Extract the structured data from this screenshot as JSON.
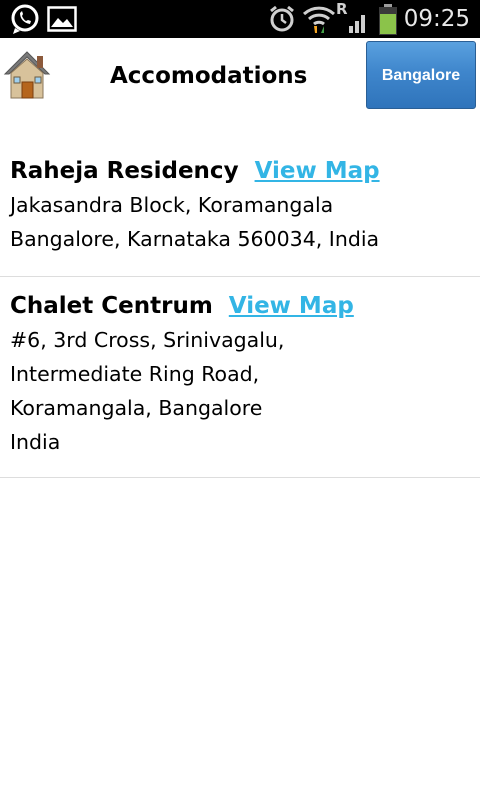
{
  "statusbar": {
    "time": "09:25",
    "icons": [
      "whatsapp-icon",
      "gallery-icon",
      "alarm-icon",
      "wifi-icon",
      "roaming-icon",
      "battery-icon"
    ],
    "roaming_label": "R",
    "battery_color": "#8bc34a"
  },
  "header": {
    "home_icon": "house-icon",
    "title": "Accomodations",
    "city_button": "Bangalore",
    "accent": "#3f86cc"
  },
  "accommodations": [
    {
      "name": "Raheja Residency",
      "link": "View Map",
      "address": [
        "Jakasandra Block, Koramangala",
        "Bangalore, Karnataka 560034, India"
      ]
    },
    {
      "name": "Chalet Centrum",
      "link": "View Map",
      "address": [
        "#6, 3rd Cross, Srinivagalu,",
        "Intermediate Ring Road,",
        "Koramangala, Bangalore",
        "India"
      ]
    }
  ],
  "colors": {
    "link": "#33b5e5",
    "divider": "#dddddd"
  }
}
